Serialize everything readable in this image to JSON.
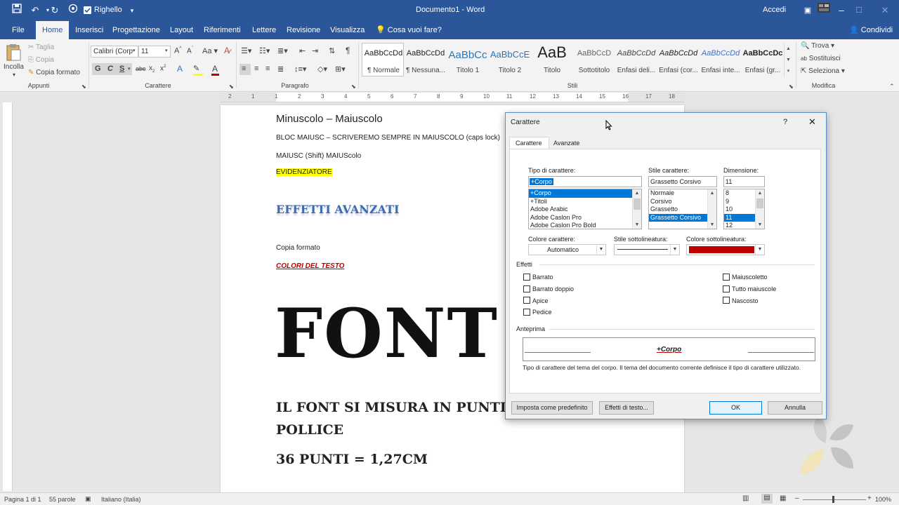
{
  "window": {
    "title": "Documento1 - Word",
    "accedi": "Accedi",
    "ruler_label": "Righello"
  },
  "ribbon_tabs": [
    "File",
    "Home",
    "Inserisci",
    "Progettazione",
    "Layout",
    "Riferimenti",
    "Lettere",
    "Revisione",
    "Visualizza"
  ],
  "tell_me": "Cosa vuoi fare?",
  "share": "Condividi",
  "clipboard": {
    "paste": "Incolla",
    "cut": "Taglia",
    "copy": "Copia",
    "format_painter": "Copia formato",
    "label": "Appunti"
  },
  "font_group": {
    "font_name": "Calibri (Corp",
    "font_size": "11",
    "bold": "G",
    "italic": "C",
    "underline": "S",
    "label": "Carattere"
  },
  "paragraph_group": {
    "label": "Paragrafo"
  },
  "styles_group": {
    "label": "Stili",
    "items": [
      {
        "preview": "AaBbCcDd",
        "name": "¶ Normale"
      },
      {
        "preview": "AaBbCcDd",
        "name": "¶ Nessuna..."
      },
      {
        "preview": "AaBbCc",
        "name": "Titolo 1"
      },
      {
        "preview": "AaBbCcE",
        "name": "Titolo 2"
      },
      {
        "preview": "AaB",
        "name": "Titolo"
      },
      {
        "preview": "AaBbCcD",
        "name": "Sottotitolo"
      },
      {
        "preview": "AaBbCcDd",
        "name": "Enfasi deli..."
      },
      {
        "preview": "AaBbCcDd",
        "name": "Enfasi (cor..."
      },
      {
        "preview": "AaBbCcDd",
        "name": "Enfasi inte..."
      },
      {
        "preview": "AaBbCcDc",
        "name": "Enfasi (gr..."
      }
    ]
  },
  "editing_group": {
    "find": "Trova",
    "replace": "Sostituisci",
    "select": "Seleziona",
    "label": "Modifica"
  },
  "ruler_numbers": [
    "2",
    "1",
    "1",
    "2",
    "3",
    "4",
    "5",
    "6",
    "7",
    "8",
    "9",
    "10",
    "11",
    "12",
    "13",
    "14",
    "15",
    "16",
    "17",
    "18"
  ],
  "document": {
    "line1": "Minuscolo – Maiuscolo",
    "line2": "BLOC MAIUSC – SCRIVEREMO SEMPRE IN MAIUSCOLO (caps lock)",
    "line3": "MAIUSC (Shift)  MAIUScolo",
    "line4": "EVIDENZIATORE",
    "line5": "EFFETTI AVANZATI",
    "line6": "Copia formato",
    "line7": "COLORI DEL TESTO",
    "big": "FONT",
    "line8": "IL FONT SI MISURA IN PUNTI / PO",
    "line9": "POLLICE",
    "line10": "36 PUNTI = 1,27CM"
  },
  "status": {
    "page": "Pagina 1 di 1",
    "words": "55 parole",
    "lang": "Italiano (Italia)",
    "zoom": "100%"
  },
  "dialog": {
    "title": "Carattere",
    "help": "?",
    "tabs": [
      "Carattere",
      "Avanzate"
    ],
    "font_label": "Tipo di carattere:",
    "font_value": "+Corpo",
    "font_list": [
      "+Corpo",
      "+Titoli",
      "Adobe Arabic",
      "Adobe Caslon Pro",
      "Adobe Caslon Pro Bold"
    ],
    "style_label": "Stile carattere:",
    "style_value": "Grassetto Corsivo",
    "style_list": [
      "Normale",
      "Corsivo",
      "Grassetto",
      "Grassetto Corsivo"
    ],
    "size_label": "Dimensione:",
    "size_value": "11",
    "size_list": [
      "8",
      "9",
      "10",
      "11",
      "12"
    ],
    "color_label": "Colore carattere:",
    "color_value": "Automatico",
    "underline_style_label": "Stile sottolineatura:",
    "underline_color_label": "Colore sottolineatura:",
    "underline_color": "#c00000",
    "effects_label": "Effetti",
    "effects_left": [
      "Barrato",
      "Barrato doppio",
      "Apice",
      "Pedice"
    ],
    "effects_right": [
      "Maiuscoletto",
      "Tutto maiuscole",
      "Nascosto"
    ],
    "preview_label": "Anteprima",
    "preview_text": "+Corpo",
    "description": "Tipo di carattere del tema del corpo. Il tema del documento corrente definisce il tipo di carattere utilizzato.",
    "btn_default": "Imposta come predefinito",
    "btn_effects": "Effetti di testo...",
    "btn_ok": "OK",
    "btn_cancel": "Annulla"
  },
  "colors": {
    "accent": "#2b579a",
    "selection": "#0078d7",
    "highlight": "#ffff00"
  }
}
